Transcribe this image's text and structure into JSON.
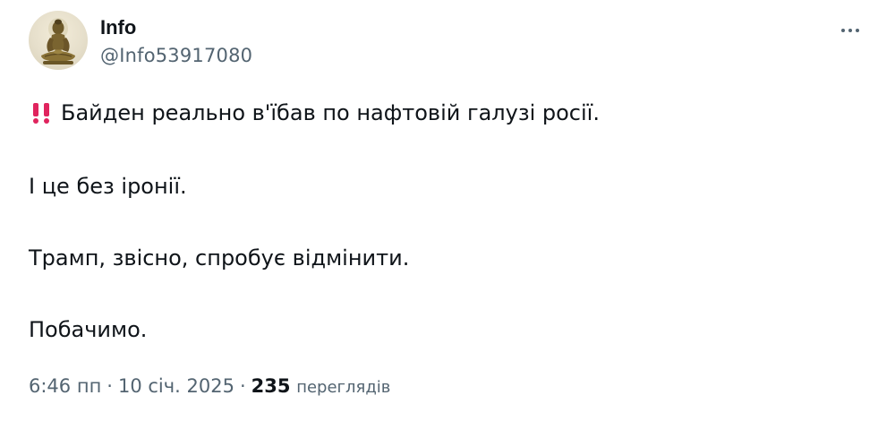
{
  "author": {
    "display_name": "Info",
    "handle": "@Info53917080",
    "avatar_icon": "buddha-statue-avatar"
  },
  "menu": {
    "more_icon": "more-dots-icon"
  },
  "tweet": {
    "lead_icon": "double-exclamation-icon",
    "lead_icon_color": "#e0245e",
    "paragraphs": [
      "Байден реально в'їбав по нафтовій галузі росії.",
      "І це без іронії.",
      "Трамп, звісно, спробує відмінити.",
      "Побачимо."
    ]
  },
  "meta": {
    "time": "6:46 пп",
    "date": "10 січ. 2025",
    "separator": "·",
    "views_count": "235",
    "views_label": "переглядів"
  },
  "colors": {
    "text_primary": "#0f1419",
    "text_secondary": "#536471",
    "background": "#ffffff"
  }
}
